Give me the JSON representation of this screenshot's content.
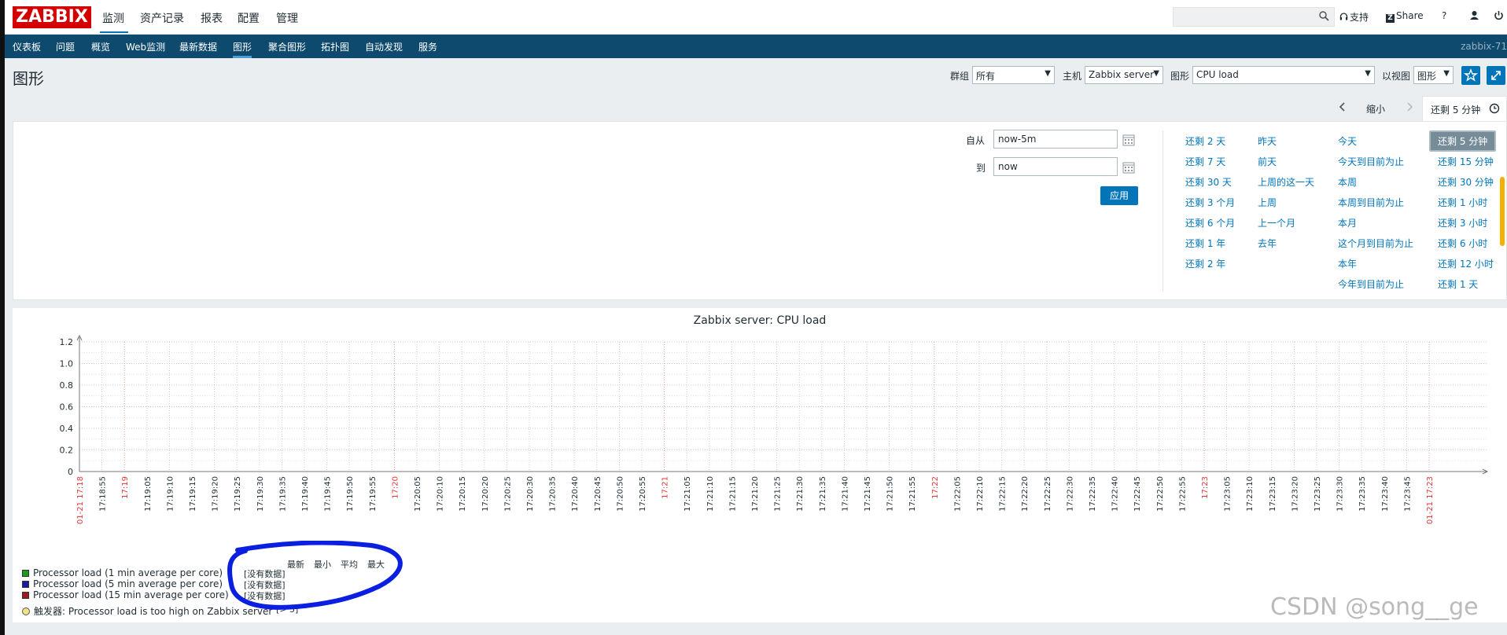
{
  "logo": "ZABBIX",
  "top_menu": [
    "监测",
    "资产记录",
    "报表",
    "配置",
    "管理"
  ],
  "top_links": {
    "support": "支持",
    "share": "Share",
    "help": "?"
  },
  "sub_nav": [
    "仪表板",
    "问题",
    "概览",
    "Web监测",
    "最新数据",
    "图形",
    "聚合图形",
    "拓扑图",
    "自动发现",
    "服务"
  ],
  "sub_nav_active": "图形",
  "server_name": "zabbix-71",
  "page_title": "图形",
  "filters": {
    "group_label": "群组",
    "group_value": "所有",
    "host_label": "主机",
    "host_value": "Zabbix server",
    "graph_label": "图形",
    "graph_value": "CPU load",
    "view_label": "以视图",
    "view_value": "图形"
  },
  "timebar": {
    "zoom_out": "缩小",
    "current": "还剩 5 分钟"
  },
  "time_filter": {
    "from_label": "自从",
    "from_value": "now-5m",
    "to_label": "到",
    "to_value": "now",
    "apply": "应用"
  },
  "quick_ranges": [
    [
      "还剩 2 天",
      "还剩 7 天",
      "还剩 30 天",
      "还剩 3 个月",
      "还剩 6 个月",
      "还剩 1 年",
      "还剩 2 年"
    ],
    [
      "昨天",
      "前天",
      "上周的这一天",
      "上周",
      "上一个月",
      "去年"
    ],
    [
      "今天",
      "今天到目前为止",
      "本周",
      "本周到目前为止",
      "本月",
      "这个月到目前为止",
      "本年",
      "今年到目前为止"
    ],
    [
      "还剩 5 分钟",
      "还剩 15 分钟",
      "还剩 30 分钟",
      "还剩 1 小时",
      "还剩 3 小时",
      "还剩 6 小时",
      "还剩 12 小时",
      "还剩 1 天"
    ]
  ],
  "quick_selected": "还剩 5 分钟",
  "chart_data": {
    "type": "line",
    "title": "Zabbix server: CPU load",
    "ylim": [
      0,
      1.2
    ],
    "yticks": [
      "1.2",
      "1.0",
      "0.8",
      "0.6",
      "0.4",
      "0.2",
      "0"
    ],
    "xticks": [
      "01-21 17:18",
      "17:18:55",
      "17:19",
      "17:19:05",
      "17:19:10",
      "17:19:15",
      "17:19:20",
      "17:19:25",
      "17:19:30",
      "17:19:35",
      "17:19:40",
      "17:19:45",
      "17:19:50",
      "17:19:55",
      "17:20",
      "17:20:05",
      "17:20:10",
      "17:20:15",
      "17:20:20",
      "17:20:25",
      "17:20:30",
      "17:20:35",
      "17:20:40",
      "17:20:45",
      "17:20:50",
      "17:20:55",
      "17:21",
      "17:21:05",
      "17:21:10",
      "17:21:15",
      "17:21:20",
      "17:21:25",
      "17:21:30",
      "17:21:35",
      "17:21:40",
      "17:21:45",
      "17:21:50",
      "17:21:55",
      "17:22",
      "17:22:05",
      "17:22:10",
      "17:22:15",
      "17:22:20",
      "17:22:25",
      "17:22:30",
      "17:22:35",
      "17:22:40",
      "17:22:45",
      "17:22:50",
      "17:22:55",
      "17:23",
      "17:23:05",
      "17:23:10",
      "17:23:15",
      "17:23:20",
      "17:23:25",
      "17:23:30",
      "17:23:35",
      "17:23:40",
      "17:23:45",
      "01-21 17:23"
    ],
    "xticks_red": [
      "01-21 17:18",
      "17:19",
      "17:20",
      "17:21",
      "17:22",
      "17:23",
      "01-21 17:23"
    ],
    "series": [
      {
        "name": "Processor load (1 min average per core)",
        "color": "#1a9c1a",
        "values": []
      },
      {
        "name": "Processor load (5 min average per core)",
        "color": "#1a1aa0",
        "values": []
      },
      {
        "name": "Processor load (15 min average per core)",
        "color": "#a01a1a",
        "values": []
      }
    ],
    "legend_headers": [
      "最新",
      "最小",
      "平均",
      "最大"
    ],
    "legend_value": "[没有数据]",
    "trigger": {
      "label": "触发器: Processor load is too high on Zabbix server",
      "threshold": "[> 5]"
    }
  },
  "watermark": "CSDN @song__ge"
}
